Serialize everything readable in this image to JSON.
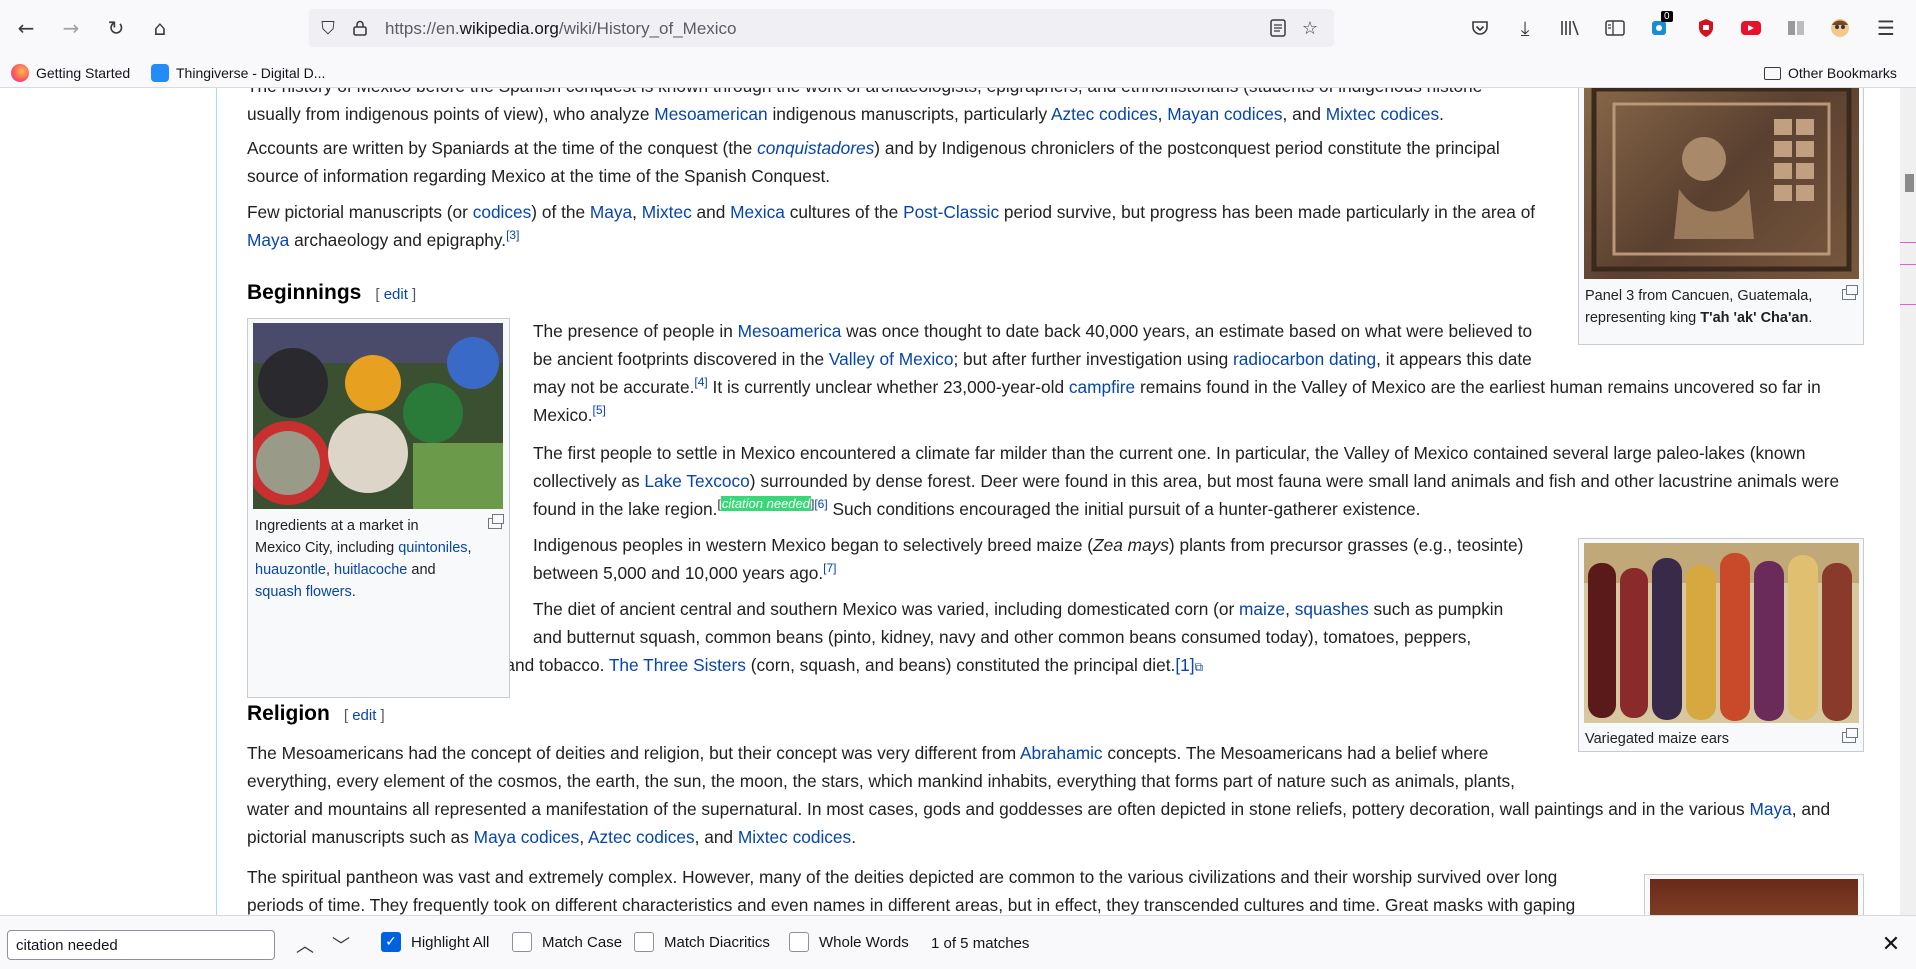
{
  "browser": {
    "url_prefix": "https://en.",
    "url_domain": "wikipedia.org",
    "url_path": "/wiki/History_of_Mexico",
    "pocket_badge": "0"
  },
  "bookmarks": {
    "items": [
      {
        "label": "Getting Started"
      },
      {
        "label": "Thingiverse - Digital D..."
      }
    ],
    "other": "Other Bookmarks"
  },
  "article": {
    "intro_p1_line1": "The history of Mexico before the Spanish conquest is known through the work of archaeologists, epigraphers, and ethnohistorians (students of indigenous historie",
    "intro_p1_line2_a": "usually from indigenous points of view), who analyze ",
    "intro_p1_link1": "Mesoamerican",
    "intro_p1_line2_b": " indigenous manuscripts, particularly ",
    "intro_p1_link2": "Aztec codices",
    "intro_p1_link3": "Mayan codices",
    "intro_p1_link4": "Mixtec codices",
    "sep_comma": ", ",
    "sep_and": ", and ",
    "period": ".",
    "intro_p2_a": "Accounts are written by Spaniards at the time of the conquest (the ",
    "intro_p2_link": "conquistadores",
    "intro_p2_b": ") and by Indigenous chroniclers of the postconquest period constitute the principal",
    "intro_p2_line2": "source of information regarding Mexico at the time of the Spanish Conquest.",
    "intro_p3_a": "Few pictorial manuscripts (or ",
    "intro_p3_link1": "codices",
    "intro_p3_b": ") of the ",
    "intro_p3_link2": "Maya",
    "intro_p3_link3": "Mixtec",
    "intro_p3_c": " and ",
    "intro_p3_link4": "Mexica",
    "intro_p3_d": " cultures of the ",
    "intro_p3_link5": "Post-Classic",
    "intro_p3_e": " period survive, but progress has been made particularly in the area of",
    "intro_p3_link6": "Maya",
    "intro_p3_f": " archaeology and epigraphy.",
    "ref3": "[3]",
    "h_beginnings": "Beginnings",
    "edit_label": "edit",
    "edit_open": "[ ",
    "edit_close": " ]",
    "b_p1_a": "The presence of people in ",
    "b_p1_link1": "Mesoamerica",
    "b_p1_b": " was once thought to date back 40,000 years, an estimate based on what were believed to",
    "b_p1_l2_a": "be ancient footprints discovered in the ",
    "b_p1_link2": "Valley of Mexico",
    "b_p1_l2_b": "; but after further investigation using ",
    "b_p1_link3": "radiocarbon dating",
    "b_p1_l2_c": ", it appears this date",
    "b_p1_l3_a": "may not be accurate.",
    "ref4": "[4]",
    "b_p1_l3_b": " It is currently unclear whether 23,000-year-old ",
    "b_p1_link4": "campfire",
    "b_p1_l3_c": " remains found in the Valley of Mexico are the earliest human remains uncovered so far in",
    "b_p1_l4": "Mexico.",
    "ref5": "[5]",
    "b_p2_l1": "The first people to settle in Mexico encountered a climate far milder than the current one. In particular, the Valley of Mexico contained several large paleo-lakes (known",
    "b_p2_l2_a": "collectively as ",
    "b_p2_link": "Lake Texcoco",
    "b_p2_l2_b": ") surrounded by dense forest. Deer were found in this area, but most fauna were small land animals and fish and other lacustrine animals were",
    "b_p2_l3_a": "found in the lake region.",
    "b_p2_cite_open": "[",
    "b_p2_cite": "citation needed",
    "b_p2_cite_close": "]",
    "ref6": "[6]",
    "b_p2_l3_b": " Such conditions encouraged the initial pursuit of a hunter-gatherer existence.",
    "b_p3_l1_a": "Indigenous peoples in western Mexico began to selectively breed maize (",
    "b_p3_italic": "Zea mays",
    "b_p3_l1_b": ") plants from precursor grasses (e.g., teosinte)",
    "b_p3_l2": "between 5,000 and 10,000 years ago.",
    "ref7": "[7]",
    "b_p4_l1_a": "The diet of ancient central and southern Mexico was varied, including domesticated corn (or ",
    "b_p4_link1": "maize",
    "b_p4_link2": "squashes",
    "b_p4_l1_b": " such as pumpkin",
    "b_p4_l2": "and butternut squash, common beans (pinto, kidney, navy and other common beans consumed today), tomatoes, peppers,",
    "b_p4_l3_a": "cassavas, pineapples, chocolate, and tobacco. ",
    "b_p4_link3": "The Three Sisters",
    "b_p4_l3_b": " (corn, squash, and beans) constituted the principal diet.",
    "ref1": "[1]",
    "h_religion": "Religion",
    "r_p1_l1_a": "The Mesoamericans had the concept of deities and religion, but their concept was very different from ",
    "r_p1_link1": "Abrahamic",
    "r_p1_l1_b": " concepts. The Mesoamericans had a belief where",
    "r_p1_l2": "everything, every element of the cosmos, the earth, the sun, the moon, the stars, which mankind inhabits, everything that forms part of nature such as animals, plants,",
    "r_p1_l3_a": "water and mountains all represented a manifestation of the supernatural. In most cases, gods and goddesses are often depicted in stone reliefs, pottery decoration, wall paintings and in the various ",
    "r_p1_link2": "Maya",
    "r_p1_l3_b": ", and",
    "r_p1_l4_a": "pictorial manuscripts such as ",
    "r_p1_link3": "Maya codices",
    "r_p1_link4": "Aztec codices",
    "r_p1_link5": "Mixtec codices",
    "r_p2_l1": "The spiritual pantheon was vast and extremely complex. However, many of the deities depicted are common to the various civilizations and their worship survived over long",
    "r_p2_l2": "periods of time. They frequently took on different characteristics and even names in different areas, but in effect, they transcended cultures and time. Great masks with gaping"
  },
  "figures": {
    "panel_caption_a": "Panel 3 from Cancuen, Guatemala,",
    "panel_caption_b": "representing king ",
    "panel_caption_bold": "T'ah 'ak' Cha'an",
    "panel_caption_c": ".",
    "market_caption_a": "Ingredients at a market in",
    "market_caption_b": "Mexico City, including ",
    "market_link1": "quintoniles",
    "market_link2": "huauzontle",
    "market_link3": "huitlacoche",
    "market_and": " and",
    "market_link4": "squash flowers",
    "maize_caption": "Variegated maize ears"
  },
  "findbar": {
    "query": "citation needed",
    "highlight_all": "Highlight All",
    "match_case": "Match Case",
    "match_diacritics": "Match Diacritics",
    "whole_words": "Whole Words",
    "status": "1 of 5 matches",
    "highlight_all_checked": true,
    "match_case_checked": false,
    "match_diacritics_checked": false,
    "whole_words_checked": false
  },
  "colors": {
    "link": "#0645ad",
    "highlight": "#38d878",
    "checkbox_accent": "#0061e0"
  }
}
